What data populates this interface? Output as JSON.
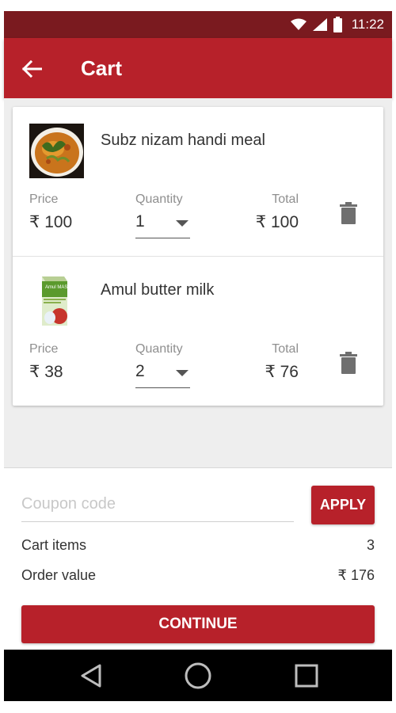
{
  "status_bar": {
    "time": "11:22",
    "icons": [
      "wifi-icon",
      "signal-icon",
      "battery-icon"
    ]
  },
  "app_bar": {
    "title": "Cart",
    "back_icon": "arrow-back-icon"
  },
  "cart": {
    "labels": {
      "price": "Price",
      "quantity": "Quantity",
      "total": "Total"
    },
    "items": [
      {
        "name": "Subz nizam handi meal",
        "price": "₹ 100",
        "quantity": "1",
        "total": "₹ 100",
        "image": "curry-bowl-image"
      },
      {
        "name": "Amul butter milk",
        "price": "₹ 38",
        "quantity": "2",
        "total": "₹ 76",
        "image": "buttermilk-pack-image"
      }
    ]
  },
  "checkout": {
    "coupon_placeholder": "Coupon code",
    "coupon_value": "",
    "apply_label": "APPLY",
    "cart_items_label": "Cart items",
    "cart_items_value": "3",
    "order_value_label": "Order value",
    "order_value": "₹ 176",
    "continue_label": "CONTINUE"
  },
  "nav_bar": {
    "icons": [
      "back-triangle-icon",
      "home-circle-icon",
      "recents-square-icon"
    ]
  },
  "colors": {
    "primary": "#b7212a",
    "status_bar": "#7a1a1f",
    "background": "#eeeeee"
  },
  "packaging_text": "Amul MASTI"
}
